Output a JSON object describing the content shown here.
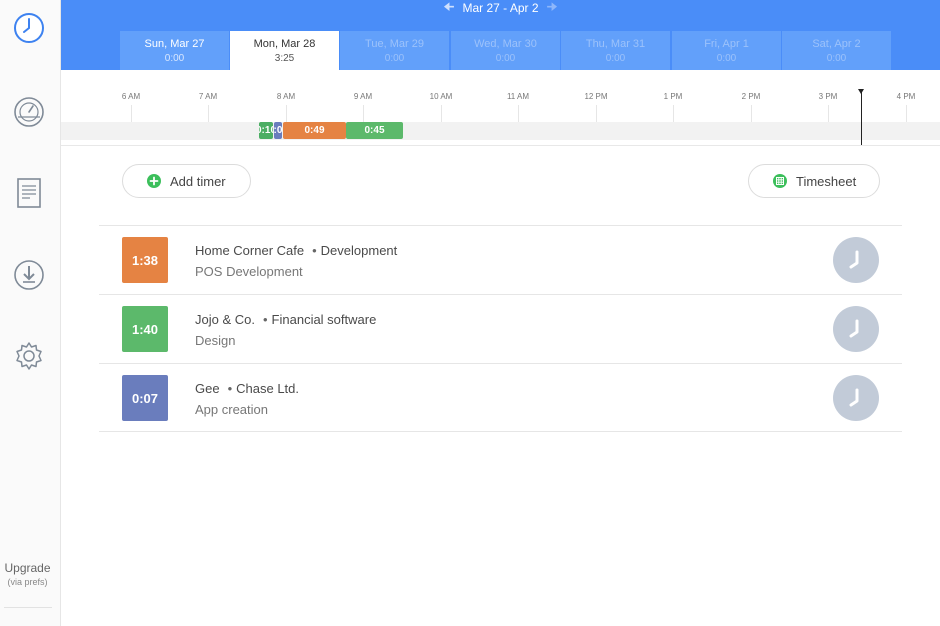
{
  "sidebar": {
    "icons": [
      "clock-icon",
      "dashboard-icon",
      "reports-icon",
      "download-icon",
      "settings-icon"
    ],
    "upgrade_label": "Upgrade",
    "upgrade_sub": "(via prefs)"
  },
  "header": {
    "date_range": "Mar 27 - Apr 2",
    "prev_icon": "arrow-left-icon",
    "next_icon": "arrow-right-icon",
    "days": [
      {
        "label": "Sun, Mar 27",
        "value": "0:00"
      },
      {
        "label": "Mon, Mar 28",
        "value": "3:25"
      },
      {
        "label": "Tue, Mar 29",
        "value": "0:00"
      },
      {
        "label": "Wed, Mar 30",
        "value": "0:00"
      },
      {
        "label": "Thu, Mar 31",
        "value": "0:00"
      },
      {
        "label": "Fri, Apr 1",
        "value": "0:00"
      },
      {
        "label": "Sat, Apr 2",
        "value": "0:00"
      }
    ]
  },
  "timeline": {
    "ticks": [
      "6 AM",
      "7 AM",
      "8 AM",
      "9 AM",
      "10 AM",
      "11 AM",
      "12 PM",
      "1 PM",
      "2 PM",
      "3 PM",
      "4 PM"
    ],
    "segments": [
      {
        "label": "0:10",
        "color": "#4cae64"
      },
      {
        "label": "0:07",
        "color": "#6a7dbd"
      },
      {
        "label": "0:49",
        "color": "#e58343"
      },
      {
        "label": "0:45",
        "color": "#5cb96b"
      }
    ]
  },
  "actions": {
    "add_timer": "Add timer",
    "timesheet": "Timesheet"
  },
  "entries": [
    {
      "duration": "1:38",
      "color": "#e58343",
      "client": "Home Corner Cafe",
      "project": "Development",
      "task": "POS Development"
    },
    {
      "duration": "1:40",
      "color": "#5cb96b",
      "client": "Jojo & Co.",
      "project": "Financial software",
      "task": "Design"
    },
    {
      "duration": "0:07",
      "color": "#6a7dbd",
      "client": "Gee",
      "project": "Chase Ltd.",
      "task": "App creation"
    }
  ],
  "colors": {
    "accent": "#4a8df8",
    "clock_button": "#c2cbd8",
    "add_green": "#3cbf5b"
  }
}
